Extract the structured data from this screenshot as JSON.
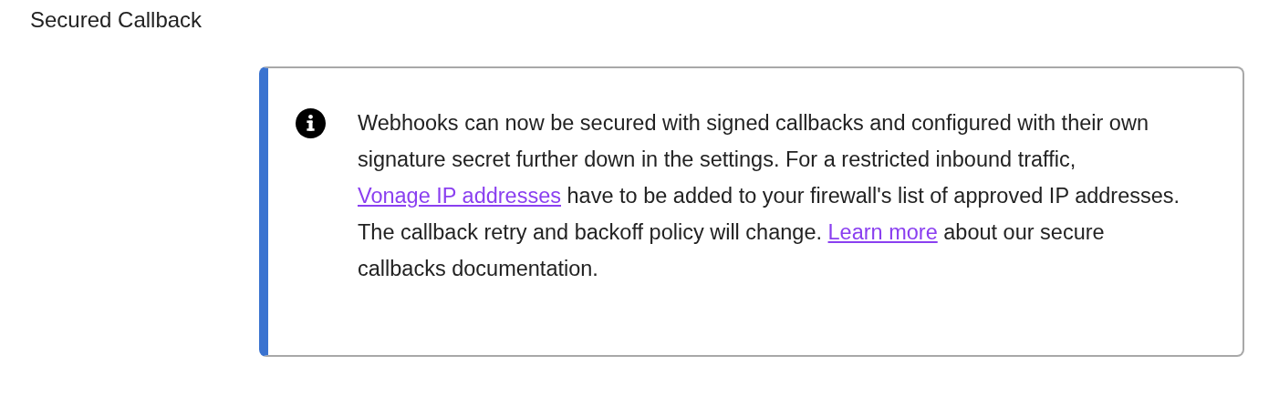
{
  "section_title": "Secured Callback",
  "notice": {
    "paragraph": [
      {
        "kind": "text",
        "text": "Webhooks can now be secured with signed callbacks and configured with their own signature secret further down in the settings. For a restricted inbound traffic, "
      },
      {
        "kind": "link",
        "text": "Vonage IP addresses"
      },
      {
        "kind": "text",
        "text": " have to be added to your firewall's list of approved IP addresses. The callback retry and backoff policy will change. "
      },
      {
        "kind": "link",
        "text": "Learn more"
      },
      {
        "kind": "text",
        "text": " about our secure callbacks documentation."
      }
    ]
  }
}
